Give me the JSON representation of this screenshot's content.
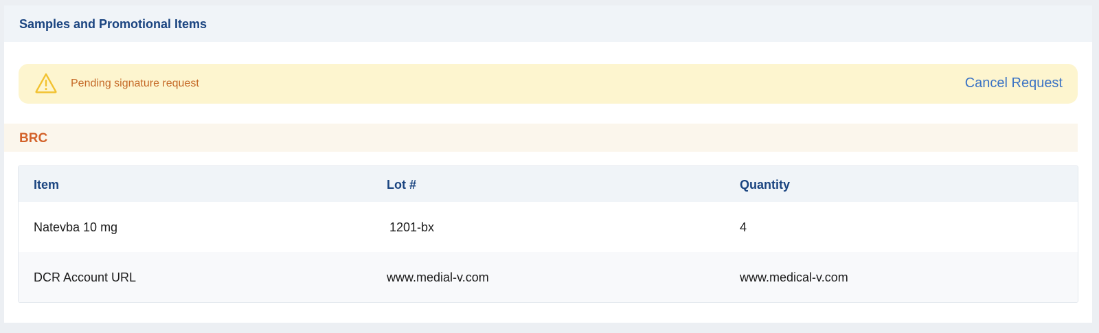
{
  "section": {
    "title": "Samples and Promotional Items"
  },
  "alert": {
    "icon": "warning-icon",
    "message": "Pending signature request",
    "action_label": "Cancel Request"
  },
  "group": {
    "label": "BRC"
  },
  "table": {
    "columns": [
      "Item",
      "Lot #",
      "Quantity"
    ],
    "rows": [
      {
        "item": "Natevba 10 mg",
        "lot": "1201-bx",
        "quantity": "4"
      },
      {
        "item": "DCR Account URL",
        "lot": "www.medial-v.com",
        "quantity": "www.medical-v.com"
      }
    ]
  },
  "colors": {
    "heading": "#1a4480",
    "alert_bg": "#fdf5cf",
    "alert_text": "#c56a28",
    "warning_icon": "#f2c230",
    "link": "#3b73c4",
    "group_label": "#d3622a"
  }
}
